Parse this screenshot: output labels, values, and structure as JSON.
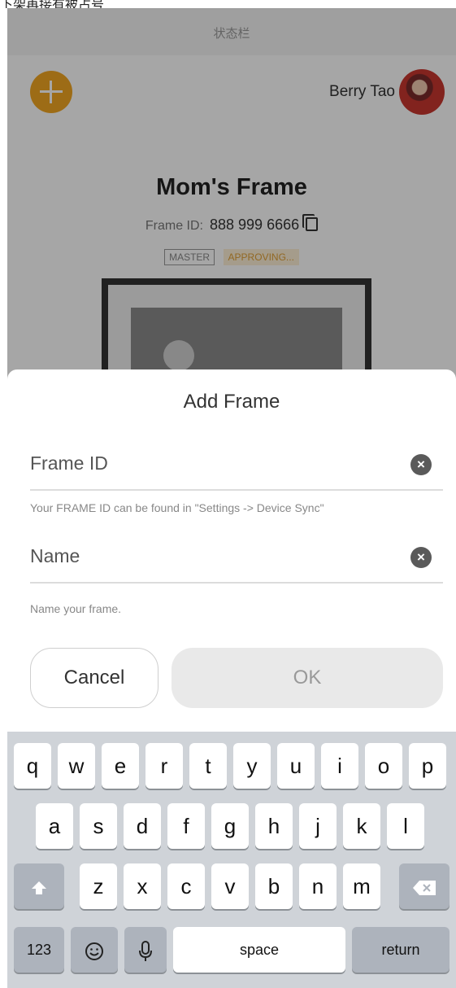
{
  "top_caption": "下架再接有被占号",
  "status_bar": {
    "label": "状态栏"
  },
  "header": {
    "user_name": "Berry Tao"
  },
  "frame": {
    "title": "Mom's Frame",
    "id_label": "Frame ID:",
    "id_value": "888 999 6666",
    "badges": [
      "MASTER",
      "APPROVING..."
    ]
  },
  "sheet": {
    "title": "Add Frame",
    "frame_id": {
      "placeholder": "Frame ID",
      "hint": "Your FRAME ID can be found in \"Settings -> Device Sync\""
    },
    "name": {
      "placeholder": "Name",
      "hint": "Name your frame."
    },
    "cancel_label": "Cancel",
    "ok_label": "OK"
  },
  "keyboard": {
    "row1": [
      "q",
      "w",
      "e",
      "r",
      "t",
      "y",
      "u",
      "i",
      "o",
      "p"
    ],
    "row2": [
      "a",
      "s",
      "d",
      "f",
      "g",
      "h",
      "j",
      "k",
      "l"
    ],
    "row3": [
      "z",
      "x",
      "c",
      "v",
      "b",
      "n",
      "m"
    ],
    "numbers_label": "123",
    "space_label": "space",
    "return_label": "return"
  },
  "colors": {
    "accent": "#f2a623",
    "approving": "#e0a037"
  }
}
